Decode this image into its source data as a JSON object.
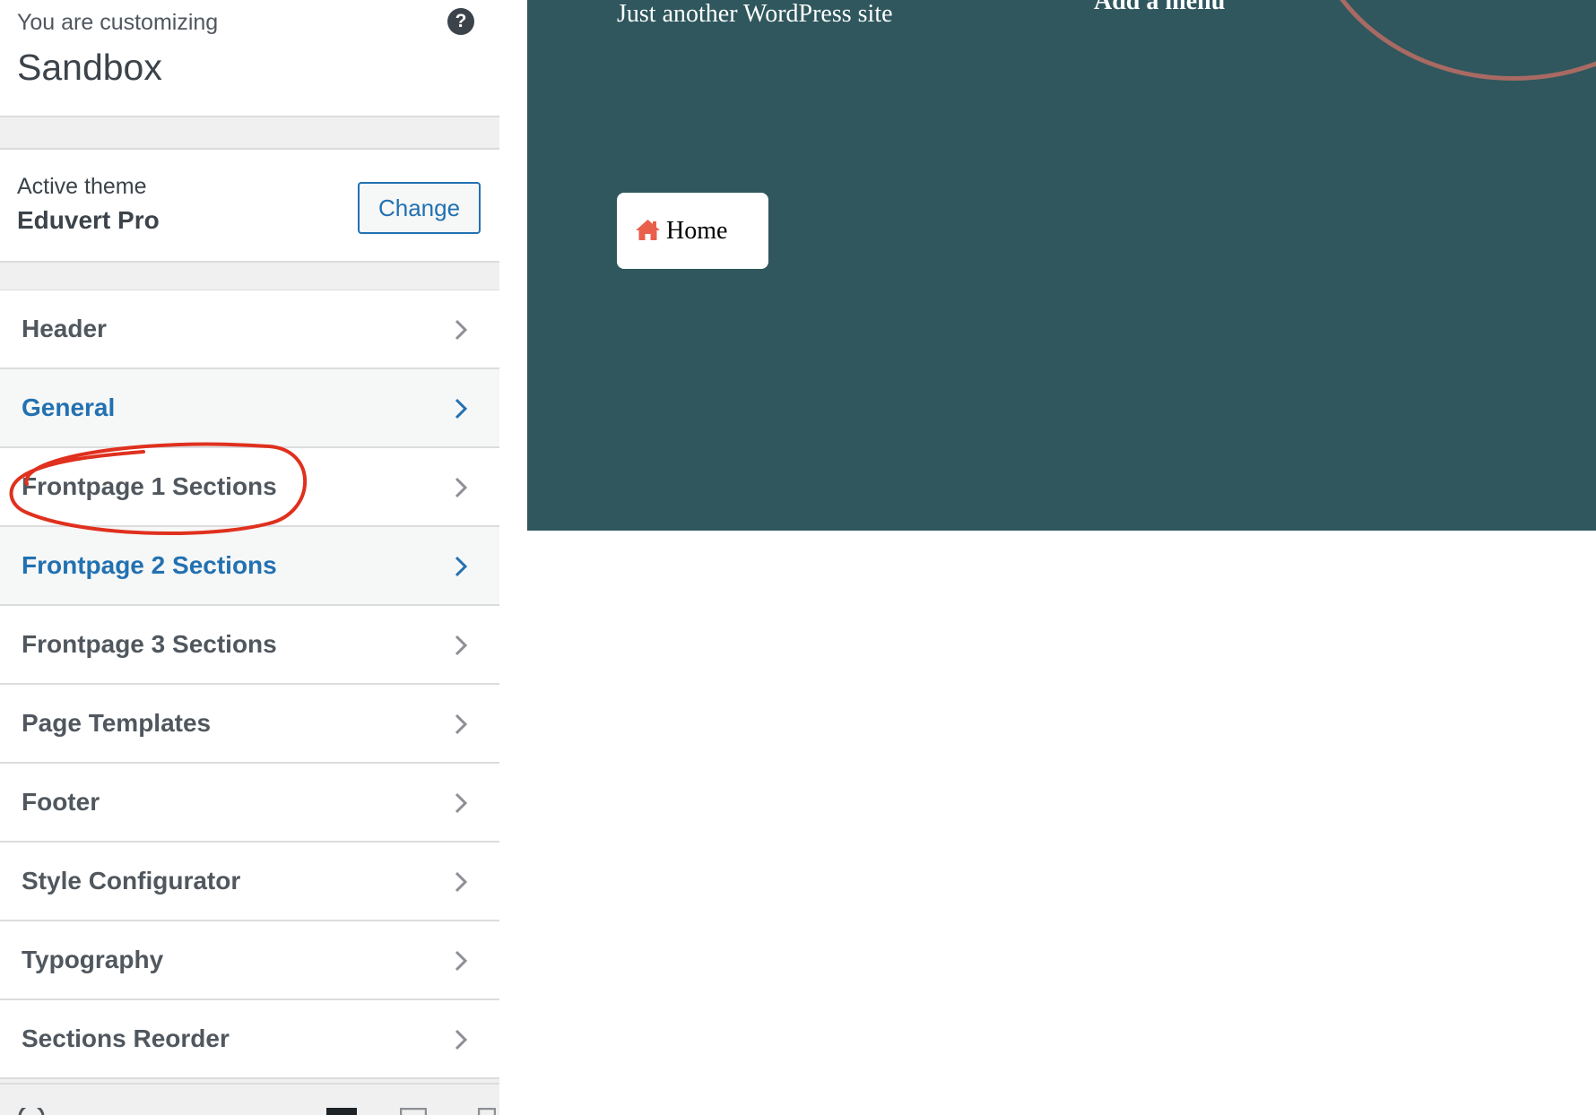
{
  "sidebar": {
    "customizing_label": "You are customizing",
    "site_name": "Sandbox",
    "help_icon": "help-circle-icon",
    "help_glyph": "?",
    "theme": {
      "active_label": "Active theme",
      "name": "Eduvert Pro",
      "change_label": "Change"
    },
    "sections": [
      {
        "label": "Header",
        "hovered": false
      },
      {
        "label": "General",
        "hovered": true
      },
      {
        "label": "Frontpage 1 Sections",
        "hovered": false
      },
      {
        "label": "Frontpage 2 Sections",
        "hovered": true
      },
      {
        "label": "Frontpage 3 Sections",
        "hovered": false
      },
      {
        "label": "Page Templates",
        "hovered": false
      },
      {
        "label": "Footer",
        "hovered": false
      },
      {
        "label": "Style Configurator",
        "hovered": false
      },
      {
        "label": "Typography",
        "hovered": false
      },
      {
        "label": "Sections Reorder",
        "hovered": false
      }
    ]
  },
  "preview": {
    "tagline": "Just another WordPress site",
    "add_menu": "Add a menu",
    "home_button": {
      "label": "Home",
      "icon": "home-icon"
    }
  },
  "colors": {
    "hero_bg": "#2f575d",
    "accent": "#2271b1",
    "home_icon": "#e8604c",
    "annotation": "#e0301e"
  }
}
